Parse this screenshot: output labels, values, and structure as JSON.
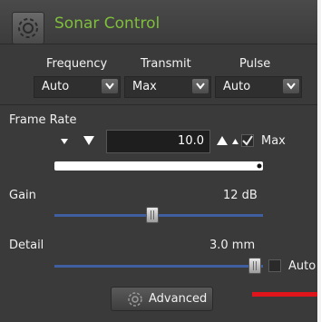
{
  "panel": {
    "title": "Sonar Control",
    "colors": {
      "title": "#7fbf3b",
      "accent_track": "#3f5fa0",
      "alert_line": "#e0141b"
    }
  },
  "dropdowns": [
    {
      "label": "Frequency",
      "value": "Auto"
    },
    {
      "label": "Transmit",
      "value": "Max"
    },
    {
      "label": "Pulse",
      "value": "Auto"
    }
  ],
  "frame_rate": {
    "label": "Frame Rate",
    "value": "10.0",
    "max_label": "Max",
    "max_checked": true
  },
  "gain": {
    "label": "Gain",
    "value": "12 dB",
    "level": 0.47
  },
  "detail": {
    "label": "Detail",
    "value": "3.0 mm",
    "level": 0.96,
    "auto_label": "Auto",
    "auto_checked": false
  },
  "advanced_button": {
    "label": "Advanced",
    "icon": "gear-icon"
  }
}
